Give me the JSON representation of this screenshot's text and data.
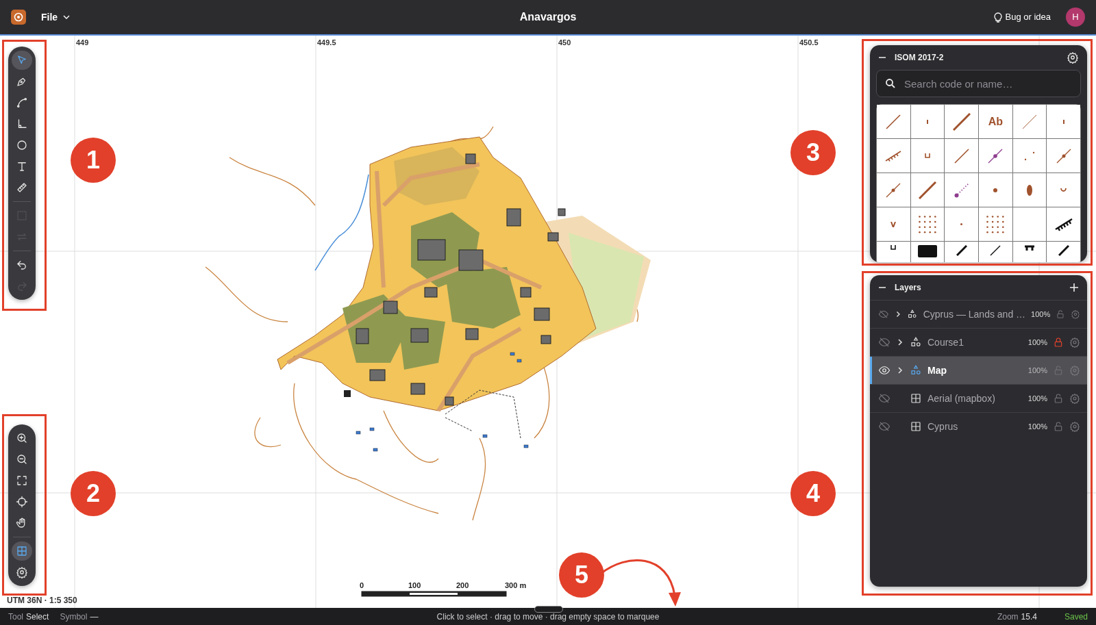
{
  "app_bar": {
    "menu": "File",
    "title": "Anavargos",
    "feedback": "Bug or idea",
    "avatar": "H"
  },
  "tools": [
    {
      "kind": "select",
      "selected": true,
      "disabled": false
    },
    {
      "kind": "pen",
      "selected": false,
      "disabled": false
    },
    {
      "kind": "curve",
      "selected": false,
      "disabled": false
    },
    {
      "kind": "angle",
      "selected": false,
      "disabled": false
    },
    {
      "kind": "circle",
      "selected": false,
      "disabled": false
    },
    {
      "kind": "text",
      "selected": false,
      "disabled": false
    },
    {
      "kind": "ruler",
      "selected": false,
      "disabled": false
    },
    {
      "kind": "divider"
    },
    {
      "kind": "marquee",
      "selected": false,
      "disabled": true
    },
    {
      "kind": "swap",
      "selected": false,
      "disabled": true
    },
    {
      "kind": "divider"
    },
    {
      "kind": "undo",
      "selected": false,
      "disabled": false
    },
    {
      "kind": "redo",
      "selected": false,
      "disabled": true
    }
  ],
  "view_tools": [
    {
      "kind": "zoom-in",
      "selected": false
    },
    {
      "kind": "zoom-out",
      "selected": false
    },
    {
      "kind": "fit",
      "selected": false
    },
    {
      "kind": "locate",
      "selected": false
    },
    {
      "kind": "pan",
      "selected": false
    },
    {
      "kind": "divider"
    },
    {
      "kind": "grid",
      "selected": true
    },
    {
      "kind": "settings",
      "selected": false
    }
  ],
  "grid_labels": [
    "449",
    "449.5",
    "450",
    "450.5"
  ],
  "projection": "UTM 36N · 1:5 350",
  "scale_bar": {
    "labels": [
      "0",
      "100",
      "200",
      "300 m"
    ]
  },
  "symbol_panel": {
    "title": "ISOM 2017-2",
    "search_placeholder": "Search code or name…",
    "symbols": [
      {
        "kind": "line"
      },
      {
        "kind": "tick"
      },
      {
        "kind": "thick-line"
      },
      {
        "kind": "text",
        "label": "Ab"
      },
      {
        "kind": "thin-line"
      },
      {
        "kind": "tick"
      },
      {
        "kind": "comb"
      },
      {
        "kind": "bracket"
      },
      {
        "kind": "line"
      },
      {
        "kind": "course-dot-line"
      },
      {
        "kind": "specks"
      },
      {
        "kind": "dot-line"
      },
      {
        "kind": "dot-line"
      },
      {
        "kind": "thick-line"
      },
      {
        "kind": "course-dotted"
      },
      {
        "kind": "dot"
      },
      {
        "kind": "oval"
      },
      {
        "kind": "arc"
      },
      {
        "kind": "v"
      },
      {
        "kind": "dots-grid"
      },
      {
        "kind": "speck"
      },
      {
        "kind": "dots-grid"
      },
      {
        "kind": "blank"
      },
      {
        "kind": "cliff-comb"
      },
      {
        "kind": "cliff-bracket"
      },
      {
        "kind": "block"
      },
      {
        "kind": "wall"
      },
      {
        "kind": "fence"
      },
      {
        "kind": "stand"
      },
      {
        "kind": "wall"
      }
    ]
  },
  "layers_panel": {
    "title": "Layers",
    "layers": [
      {
        "name": "Cyprus — Lands and …",
        "kind": "vector",
        "visible": false,
        "expandable": true,
        "opacity": "100%",
        "locked": false,
        "selected": false
      },
      {
        "name": "Course1",
        "kind": "vector",
        "visible": false,
        "expandable": true,
        "opacity": "100%",
        "locked": true,
        "selected": false
      },
      {
        "name": "Map",
        "kind": "vector",
        "visible": true,
        "expandable": true,
        "opacity": "100%",
        "locked": false,
        "selected": true
      },
      {
        "name": "Aerial (mapbox)",
        "kind": "raster",
        "visible": false,
        "expandable": false,
        "opacity": "100%",
        "locked": false,
        "selected": false
      },
      {
        "name": "Cyprus",
        "kind": "raster",
        "visible": false,
        "expandable": false,
        "opacity": "100%",
        "locked": false,
        "selected": false
      }
    ]
  },
  "status_bar": {
    "tool_label": "Tool",
    "tool": "Select",
    "symbol_label": "Symbol",
    "symbol": "—",
    "hint": "Click to select · drag to move · drag empty space to marquee",
    "zoom_label": "Zoom",
    "zoom": "15.4",
    "save_state": "Saved"
  },
  "annotations": [
    {
      "label": "1"
    },
    {
      "label": "2"
    },
    {
      "label": "3"
    },
    {
      "label": "4"
    },
    {
      "label": "5"
    }
  ]
}
